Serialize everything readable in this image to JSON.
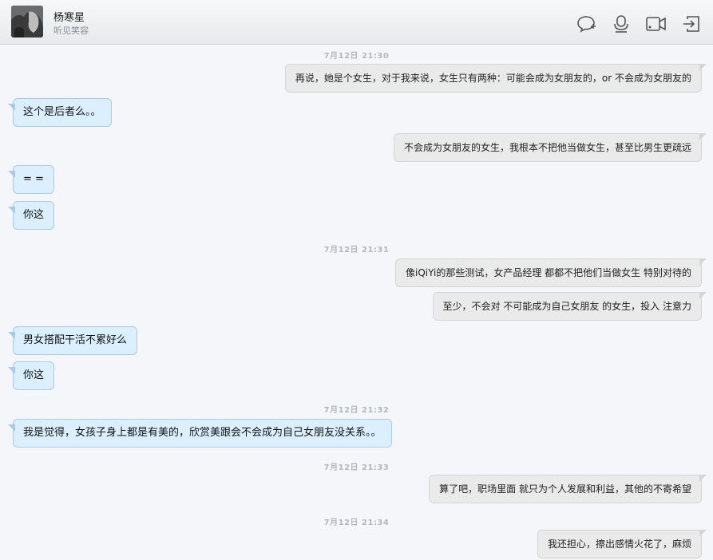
{
  "contact": {
    "name": "杨寒星",
    "status": "听见笑容"
  },
  "header_icons": [
    "chat-add-icon",
    "microphone-icon",
    "video-camera-icon",
    "share-exit-icon"
  ],
  "colors": {
    "incoming": "#dcefff",
    "outgoing": "#eaeaeb",
    "background": "#f4f6f9"
  },
  "messages": {
    "t1": "7月12日  21:30",
    "m1": "再说，她是个女生，对于我来说，女生只有两种：可能会成为女朋友的，or 不会成为女朋友的",
    "m2": "这个是后者么。。",
    "m3": "不会成为女朋友的女生，我根本不把他当做女生，甚至比男生更疏远",
    "m4": "= =",
    "m5": "你这",
    "t2": "7月12日  21:31",
    "m6": "像iQiYi的那些测试，女产品经理 都都不把他们当做女生 特别对待的",
    "m7": "至少，不会对 不可能成为自己女朋友 的女生，投入 注意力",
    "m8": "男女搭配干活不累好么",
    "m9": "你这",
    "t3": "7月12日  21:32",
    "m10": "我是觉得，女孩子身上都是有美的，欣赏美跟会不会成为自己女朋友没关系。。",
    "t4": "7月12日  21:33",
    "m11": "算了吧，职场里面 就只为个人发展和利益，其他的不寄希望",
    "t5": "7月12日  21:34",
    "m12": "我还担心，擦出感情火花了，麻烦"
  }
}
